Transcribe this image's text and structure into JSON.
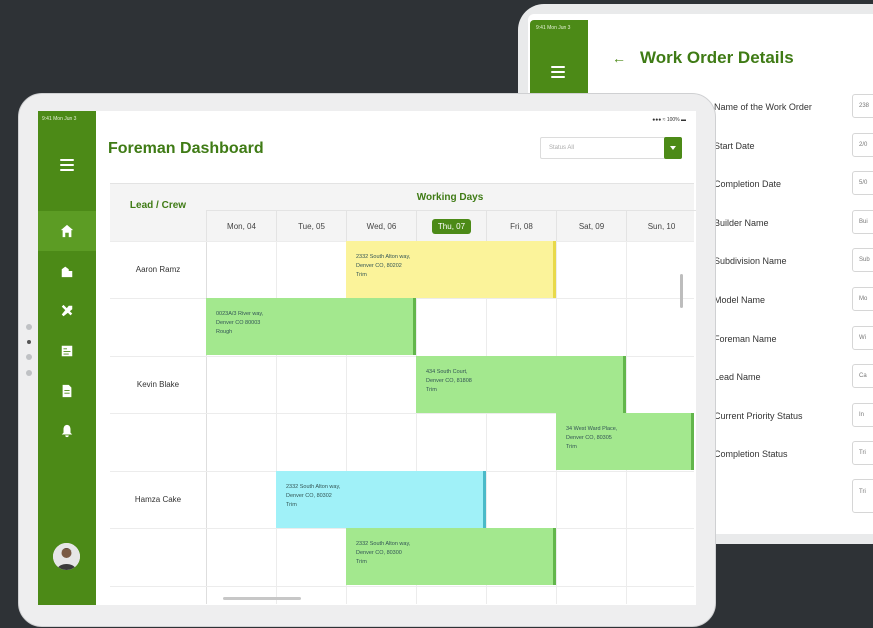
{
  "work_order": {
    "status_time": "9:41 Mon Jun 3",
    "title": "Work Order Details",
    "fields": [
      {
        "label": "Name of the Work Order",
        "value": "238"
      },
      {
        "label": "Start Date",
        "value": "2/0"
      },
      {
        "label": "Completion Date",
        "value": "5/0"
      },
      {
        "label": "Builder Name",
        "value": "Bui"
      },
      {
        "label": "Subdivision Name",
        "value": "Sub"
      },
      {
        "label": "Model Name",
        "value": "Mo"
      },
      {
        "label": "Foreman Name",
        "value": "Wi"
      },
      {
        "label": "Lead Name",
        "value": "Ca"
      },
      {
        "label": "Current Priority Status",
        "value": "In"
      },
      {
        "label": "Completion Status",
        "value": "Tri"
      }
    ],
    "notes_value": "Tri"
  },
  "dashboard": {
    "status_time": "9:41 Mon Jun 3",
    "status_right": "100%",
    "title": "Foreman Dashboard",
    "filter_placeholder": "Status All",
    "grid": {
      "lead_header": "Lead / Crew",
      "days_header": "Working Days",
      "days": [
        "Mon, 04",
        "Tue, 05",
        "Wed, 06",
        "Thu, 07",
        "Fri, 08",
        "Sat, 09",
        "Sun, 10"
      ],
      "active_day": "Thu, 07",
      "rows": [
        "Aaron Ramz",
        "",
        "Kevin Blake",
        "",
        "Hamza Cake",
        ""
      ],
      "events": [
        {
          "line1": "2332 South Alton way,",
          "line2": "Denver CO, 80202",
          "line3": "Trim"
        },
        {
          "line1": "0023A/3 River way,",
          "line2": "Denver CO 80003",
          "line3": "Rough"
        },
        {
          "line1": "434 South Court,",
          "line2": "Denver CO, 81808",
          "line3": "Trim"
        },
        {
          "line1": "34 West Ward Place,",
          "line2": "Denver CO, 80305",
          "line3": "Trim"
        },
        {
          "line1": "2332 South Alton way,",
          "line2": "Denver CO, 80302",
          "line3": "Trim"
        },
        {
          "line1": "2332 South Alton way,",
          "line2": "Denver CO, 80300",
          "line3": "Trim"
        }
      ]
    },
    "nav": [
      "home-icon",
      "buildings-icon",
      "tools-icon",
      "report-icon",
      "document-icon",
      "bell-icon"
    ],
    "colors": {
      "brand": "#4c8a17",
      "yellow": "#fbf39a",
      "green": "#a3e88e",
      "cyan": "#a0f1f8"
    }
  }
}
